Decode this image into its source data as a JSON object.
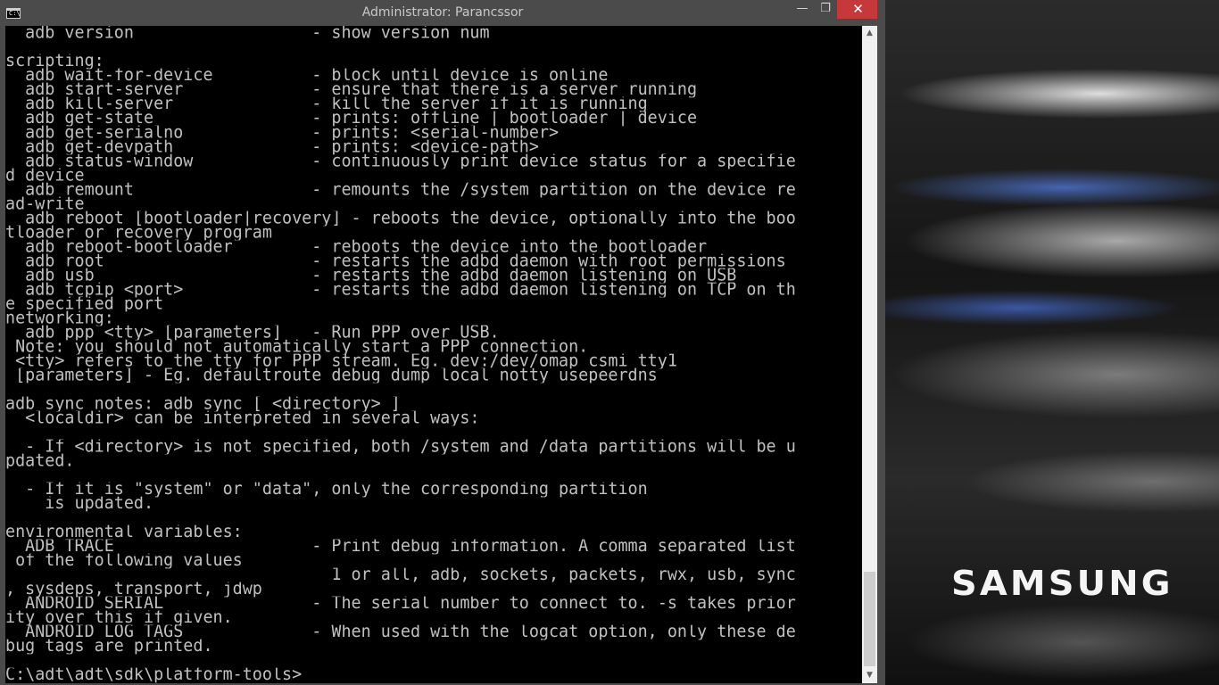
{
  "window": {
    "title": "Administrator: Parancssor",
    "icon_text": "C:\\",
    "minimize_glyph": "—",
    "maximize_glyph": "❐",
    "close_glyph": "✕"
  },
  "console": {
    "lines": [
      "  adb version                  - show version num",
      "",
      "scripting:",
      "  adb wait-for-device          - block until device is online",
      "  adb start-server             - ensure that there is a server running",
      "  adb kill-server              - kill the server if it is running",
      "  adb get-state                - prints: offline | bootloader | device",
      "  adb get-serialno             - prints: <serial-number>",
      "  adb get-devpath              - prints: <device-path>",
      "  adb status-window            - continuously print device status for a specifie",
      "d device",
      "  adb remount                  - remounts the /system partition on the device re",
      "ad-write",
      "  adb reboot [bootloader|recovery] - reboots the device, optionally into the boo",
      "tloader or recovery program",
      "  adb reboot-bootloader        - reboots the device into the bootloader",
      "  adb root                     - restarts the adbd daemon with root permissions",
      "  adb usb                      - restarts the adbd daemon listening on USB",
      "  adb tcpip <port>             - restarts the adbd daemon listening on TCP on th",
      "e specified port",
      "networking:",
      "  adb ppp <tty> [parameters]   - Run PPP over USB.",
      " Note: you should not automatically start a PPP connection.",
      " <tty> refers to the tty for PPP stream. Eg. dev:/dev/omap_csmi_tty1",
      " [parameters] - Eg. defaultroute debug dump local notty usepeerdns",
      "",
      "adb sync notes: adb sync [ <directory> ]",
      "  <localdir> can be interpreted in several ways:",
      "",
      "  - If <directory> is not specified, both /system and /data partitions will be u",
      "pdated.",
      "",
      "  - If it is \"system\" or \"data\", only the corresponding partition",
      "    is updated.",
      "",
      "environmental variables:",
      "  ADB_TRACE                    - Print debug information. A comma separated list",
      " of the following values",
      "                                 1 or all, adb, sockets, packets, rwx, usb, sync",
      ", sysdeps, transport, jdwp",
      "  ANDROID_SERIAL               - The serial number to connect to. -s takes prior",
      "ity over this if given.",
      "  ANDROID_LOG_TAGS             - When used with the logcat option, only these de",
      "bug tags are printed.",
      "",
      "C:\\adt\\adt\\sdk\\platform-tools>"
    ]
  },
  "scrollbar": {
    "up_glyph": "▲",
    "down_glyph": "▼"
  },
  "desktop": {
    "brand_logo": "SAMSUNG"
  }
}
